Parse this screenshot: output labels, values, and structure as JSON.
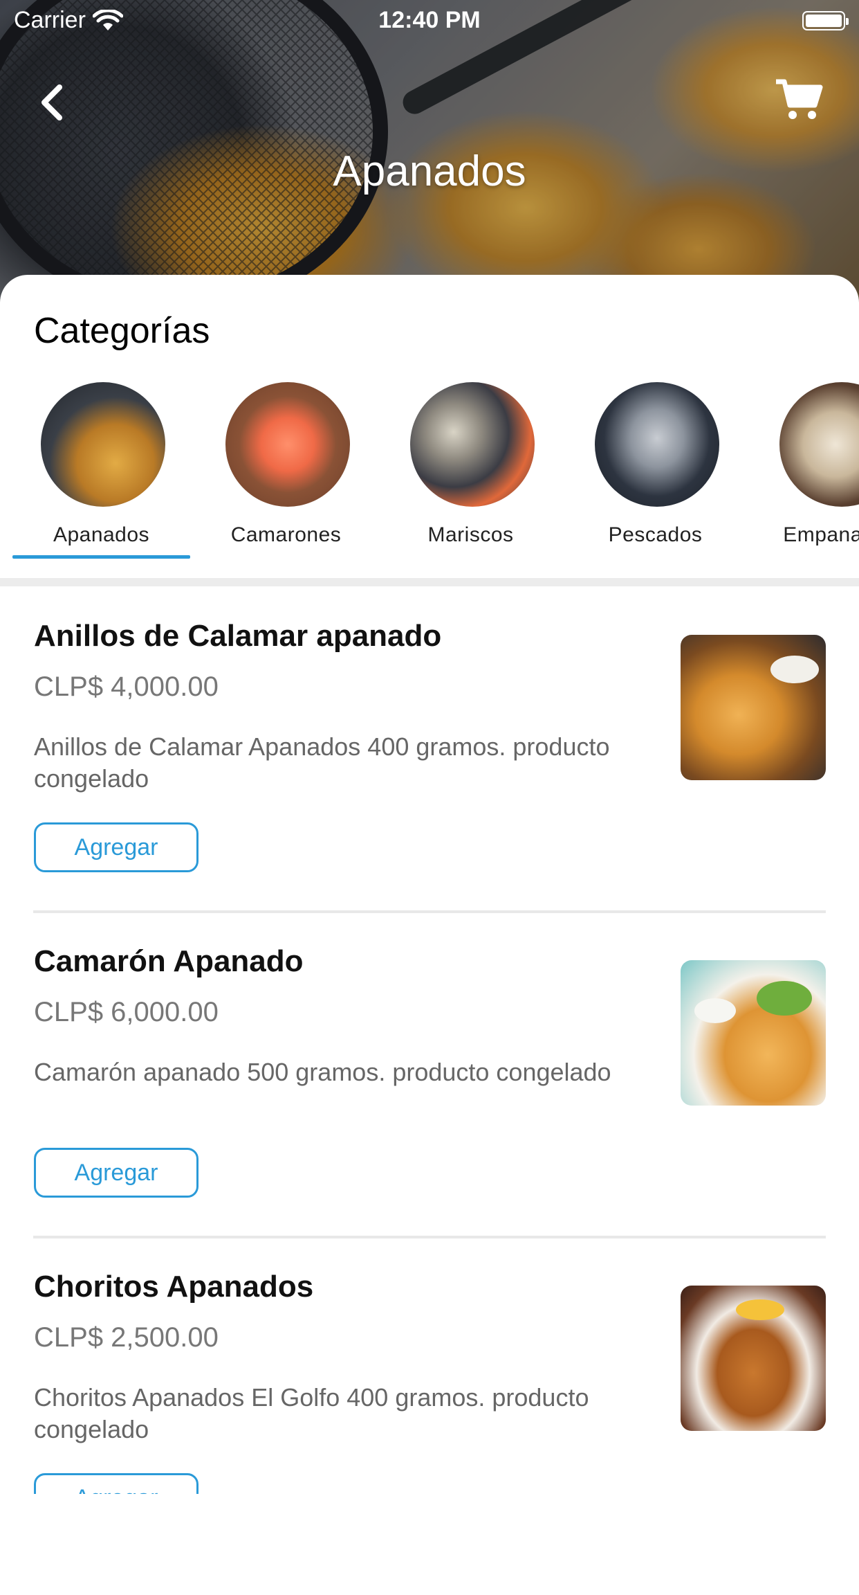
{
  "status_bar": {
    "carrier": "Carrier",
    "time": "12:40 PM"
  },
  "header": {
    "title": "Apanados",
    "back_icon": "chevron-left-icon",
    "cart_icon": "cart-icon"
  },
  "categories": {
    "title": "Categorías",
    "selected": "Apanados",
    "accent_color": "#2a9ad8",
    "items": [
      {
        "label": "Apanados"
      },
      {
        "label": "Camarones"
      },
      {
        "label": "Mariscos"
      },
      {
        "label": "Pescados"
      },
      {
        "label": "Empanadas"
      }
    ]
  },
  "products": [
    {
      "name": "Anillos de Calamar apanado",
      "price": "CLP$ 4,000.00",
      "description": "Anillos de Calamar Apanados 400 gramos. producto congelado",
      "button": "Agregar"
    },
    {
      "name": "Camarón Apanado",
      "price": "CLP$ 6,000.00",
      "description": "Camarón apanado 500 gramos. producto congelado",
      "button": "Agregar"
    },
    {
      "name": "Choritos Apanados",
      "price": "CLP$ 2,500.00",
      "description": "Choritos Apanados El Golfo 400 gramos. producto congelado",
      "button": "Agregar"
    }
  ]
}
